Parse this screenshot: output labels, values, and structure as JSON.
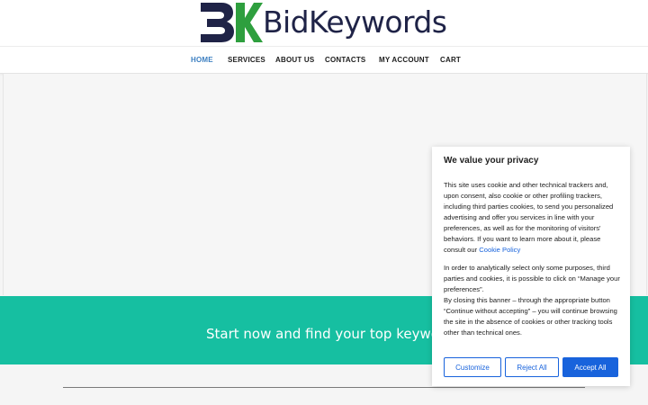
{
  "brand": {
    "name": "BidKeywords",
    "colors": {
      "dark": "#1f2347",
      "green": "#2e9f3e",
      "accent": "#3c7fc1",
      "teal": "#16bfa1",
      "cookie_blue": "#1863dc"
    }
  },
  "nav": {
    "items": [
      {
        "label": "HOME",
        "active": true
      },
      {
        "label": "SERVICES"
      },
      {
        "label": "ABOUT US"
      },
      {
        "label": "CONTACTS"
      },
      {
        "label": "MY ACCOUNT"
      },
      {
        "label": "CART"
      }
    ]
  },
  "band": {
    "text": "Start now and find your top keyword"
  },
  "cookie": {
    "title": "We value your privacy",
    "p1_text": "This site uses cookie and other technical trackers and, upon consent, also cookie or other profiling trackers, including third parties cookies, to send you personalized advertising and offer you services in line with your preferences, as well as for the monitoring of visitors' behaviors. If you want to learn more about it, please consult our ",
    "policy_link": "Cookie Policy",
    "p2": "In order to analytically select only some purposes, third parties and cookies, it is possible to click on “Manage your preferences”.",
    "p3": "By closing this banner – through the appropriate button “Continue without accepting” – you will continue browsing the site in the absence of cookies or other tracking tools other than technical ones.",
    "buttons": {
      "customize": "Customize",
      "reject": "Reject All",
      "accept": "Accept All"
    }
  }
}
